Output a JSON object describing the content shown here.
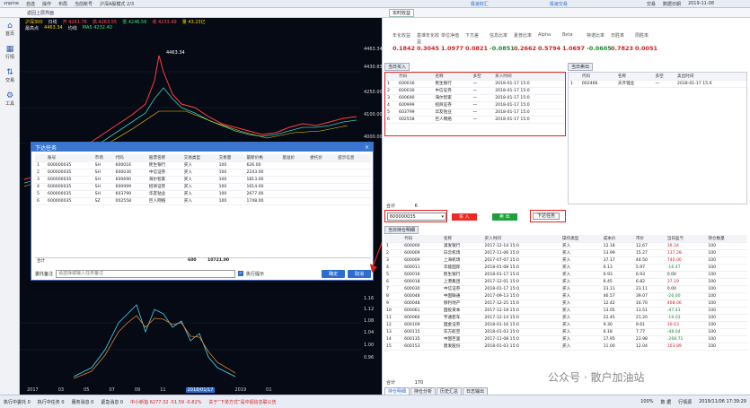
{
  "titlebar": {
    "app": "vnpine",
    "items": [
      "自选",
      "操作",
      "布局",
      "当前账号",
      "沪深A股模式 2/3"
    ],
    "center": "极速财汇",
    "center2": "极速交易",
    "right": [
      "交易",
      "数据日期",
      "2019-11-08"
    ]
  },
  "nav": {
    "back_label": "返回上层界面",
    "tab_label": "沪深A股"
  },
  "sidebar": [
    {
      "icon": "home-icon",
      "glyph": "⌂",
      "label": "首页"
    },
    {
      "icon": "chart-icon",
      "glyph": "▦",
      "label": "行情"
    },
    {
      "icon": "trade-icon",
      "glyph": "⇅",
      "label": "交易"
    },
    {
      "icon": "tools-icon",
      "glyph": "⚙",
      "label": "工具"
    }
  ],
  "chart": {
    "symbol": "沪深300",
    "row1": [
      "日线",
      "开 4261.76",
      "高 4263.55",
      "低 4246.56",
      "收 4233.49",
      "量 43.23亿"
    ],
    "row2": [
      "最高点",
      "4463.34",
      "均线",
      "MA5 4232.40"
    ],
    "price_ticks": [
      "4463.34",
      "4430.83",
      "4250.00",
      "4100.00",
      "4000.00",
      "3900.00",
      "3800.00",
      "3700.00"
    ],
    "lower_ticks": [
      "1.16",
      "1.14",
      "1.12",
      "1.10",
      "1.08",
      "1.06",
      "1.04",
      "1.02",
      "1.00",
      "0.98",
      "0.96"
    ],
    "dates": [
      "2017",
      "03",
      "05",
      "07",
      "09",
      "11",
      "2018/01/17",
      "2019",
      "01",
      "03",
      "05"
    ],
    "high_label": "4463.34"
  },
  "dialog": {
    "title": "下达任务",
    "headers": [
      "",
      "账号",
      "市场",
      "代码",
      "股票名称",
      "交易类型",
      "交易量",
      "最新价格",
      "基准价",
      "委托价",
      "提示信息"
    ],
    "rows": [
      [
        "1",
        "600000035",
        "SH",
        "600016",
        "民生银行",
        "买入",
        "100",
        "626.00",
        "",
        "",
        ""
      ],
      [
        "2",
        "600000035",
        "SH",
        "600030",
        "中信证券",
        "买入",
        "100",
        "2243.00",
        "",
        "",
        ""
      ],
      [
        "3",
        "600000035",
        "SH",
        "600690",
        "海尔智家",
        "买入",
        "100",
        "1813.00",
        "",
        "",
        ""
      ],
      [
        "4",
        "600000035",
        "SH",
        "600999",
        "招商证券",
        "买入",
        "100",
        "1614.00",
        "",
        "",
        ""
      ],
      [
        "5",
        "600000035",
        "SH",
        "603799",
        "华友钴业",
        "买入",
        "100",
        "2677.00",
        "",
        "",
        ""
      ],
      [
        "6",
        "600000035",
        "SZ",
        "002558",
        "巨人网络",
        "买入",
        "100",
        "1748.00",
        "",
        "",
        ""
      ]
    ],
    "total_label": "合计",
    "total_qty": "600",
    "total_amount": "10721.00",
    "remark_label": "委托备注",
    "remark_placeholder": "请选择或输入任务备注",
    "checkbox_label": "执行提示",
    "confirm": "确定",
    "cancel": "取消"
  },
  "right": {
    "tab": "实时收益",
    "stats": [
      {
        "label": "年化收益",
        "value": "0.1842",
        "color": "#d02020"
      },
      {
        "label": "基准年化收益",
        "value": "0.3045",
        "color": "#d02020"
      },
      {
        "label": "单位净值",
        "value": "1.0977",
        "color": "#d02020"
      },
      {
        "label": "下方差",
        "value": "0.0821",
        "color": "#d02020"
      },
      {
        "label": "信息比率",
        "value": "-0.0851",
        "color": "#1a8a2a"
      },
      {
        "label": "夏普比率",
        "value": "0.2662",
        "color": "#d02020"
      },
      {
        "label": "Alpha",
        "value": "0.5794",
        "color": "#d02020"
      },
      {
        "label": "Beta",
        "value": "1.0697",
        "color": "#d02020"
      },
      {
        "label": "特诺比率",
        "value": "-0.0605",
        "color": "#1a8a2a"
      },
      {
        "label": "日胜率",
        "value": "0.7823",
        "color": "#d02020"
      },
      {
        "label": "周胜率",
        "value": "0.0051",
        "color": "#d02020"
      }
    ],
    "buy_panel": {
      "title": "当日买入",
      "headers": [
        "",
        "代码",
        "名称",
        "多空",
        "买入时间"
      ],
      "rows": [
        [
          "1",
          "600016",
          "民生银行",
          "一",
          "2018-01-17 15:0"
        ],
        [
          "2",
          "600030",
          "中信证券",
          "一",
          "2018-01-17 15:0"
        ],
        [
          "3",
          "600690",
          "海尔智家",
          "一",
          "2018-01-17 15:0"
        ],
        [
          "4",
          "600999",
          "招商证券",
          "一",
          "2018-01-17 15:0"
        ],
        [
          "5",
          "603799",
          "华友钴业",
          "一",
          "2018-01-17 15:0"
        ],
        [
          "6",
          "002558",
          "巨人网络",
          "一",
          "2018-01-17 15:0"
        ]
      ],
      "total_label": "合计",
      "total_value": "6"
    },
    "sell_panel": {
      "title": "当日卖出",
      "headers": [
        "",
        "代码",
        "名称",
        "多空",
        "卖出时间"
      ],
      "rows": [
        [
          "1",
          "002466",
          "天齐锂业",
          "一",
          "2018-01-17 15:0"
        ]
      ]
    },
    "account": "600000035",
    "buy_btn": "买 入",
    "sell_btn": "卖 出",
    "order_btn": "下达任务",
    "hold_panel": {
      "title": "当日持仓明细",
      "headers": [
        "",
        "代码",
        "名称",
        "买入时间",
        "操作类型",
        "成本价",
        "市价",
        "当日盈亏",
        "持仓数量"
      ],
      "rows": [
        [
          "1",
          "600000",
          "浦发银行",
          "2017-12-14 15:0",
          "买入",
          "12.18",
          "12.67",
          "39.34",
          "100"
        ],
        [
          "2",
          "600009",
          "白云机场",
          "2017-11-06 15:0",
          "买入",
          "13.99",
          "15.27",
          "137.28",
          "100"
        ],
        [
          "3",
          "600009",
          "上海机场",
          "2017-07-07 15:0",
          "买入",
          "37.17",
          "44.50",
          "740.00",
          "100"
        ],
        [
          "4",
          "600011",
          "华能国际",
          "2018-01-08 15:0",
          "买入",
          "6.13",
          "5.97",
          "-16.47",
          "100"
        ],
        [
          "5",
          "600016",
          "民生银行",
          "2018-01-17 15:0",
          "买入",
          "6.93",
          "6.93",
          "0.00",
          "100"
        ],
        [
          "6",
          "600018",
          "上港集团",
          "2017-12-01 15:0",
          "买入",
          "6.45",
          "6.82",
          "37.19",
          "100"
        ],
        [
          "7",
          "600030",
          "中信证券",
          "2018-01-17 15:0",
          "买入",
          "23.11",
          "23.11",
          "0.00",
          "100"
        ],
        [
          "8",
          "600048",
          "中国联通",
          "2017-09-13 15:0",
          "买入",
          "46.57",
          "39.07",
          "-26.00",
          "100"
        ],
        [
          "9",
          "600048",
          "保利地产",
          "2017-12-25 15:0",
          "买入",
          "12.42",
          "16.70",
          "408.06",
          "100"
        ],
        [
          "10",
          "600061",
          "国投资本",
          "2017-12-18 15:0",
          "买入",
          "13.05",
          "13.51",
          "-47.43",
          "100"
        ],
        [
          "11",
          "600066",
          "宇通客车",
          "2017-12-14 15:0",
          "买入",
          "22.45",
          "21.20",
          "-19.03",
          "100"
        ],
        [
          "12",
          "600109",
          "国金证券",
          "2018-01-16 15:0",
          "买入",
          "9.30",
          "9.61",
          "30.63",
          "100"
        ],
        [
          "13",
          "600115",
          "东方航空",
          "2018-01-03 15:0",
          "买入",
          "6.18",
          "7.77",
          "-48.04",
          "100"
        ],
        [
          "14",
          "600135",
          "中国巨里",
          "2017-11-08 15:0",
          "买入",
          "17.95",
          "23.98",
          "-268.71",
          "100"
        ],
        [
          "15",
          "600153",
          "建发股份",
          "2018-01-03 15:0",
          "买入",
          "11.00",
          "12.04",
          "103.89",
          "100"
        ]
      ],
      "total_label": "合计",
      "total_value": "170"
    },
    "bottom_tabs": [
      "持仓明细",
      "持仓分析",
      "历史汇总",
      "日志输出"
    ]
  },
  "statusbar": [
    "执行中委托 0",
    "执行中任务 0",
    "服务消息 0",
    "紧急消息 0",
    "中小新指 6277.32 -51.59 -0.82%",
    "关于“下单方式”是中铝信息联公告"
  ],
  "statusbar_right": [
    "100%",
    "数 据",
    "行情源",
    "2019/11/06 17:39:29"
  ],
  "watermark": "公众号 · 散户加油站",
  "colors": {
    "accent": "#2d6cd0",
    "up": "#d02020",
    "down": "#1a8a2a",
    "highlight": "#e02020"
  }
}
